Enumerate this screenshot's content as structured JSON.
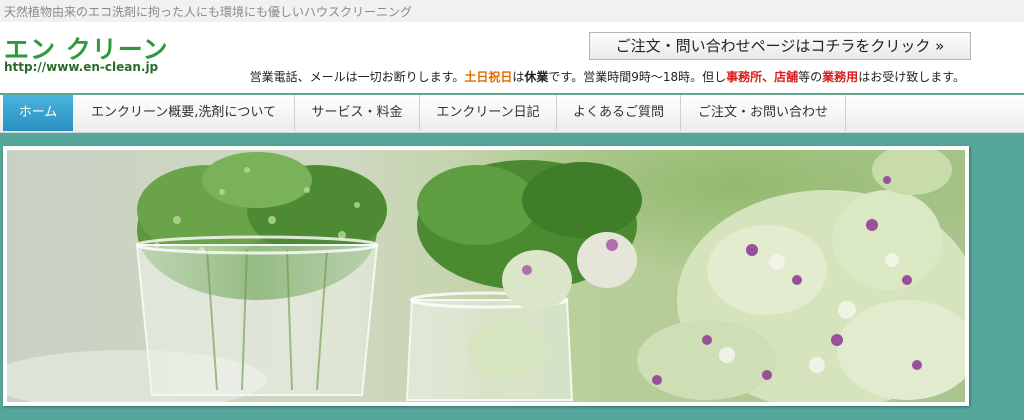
{
  "header": {
    "tagline": "天然植物由来のエコ洗剤に拘った人にも環境にも優しいハウスクリーニング",
    "logo": "エン クリーン",
    "url": "http://www.en-clean.jp",
    "contact_button": "ご注文・問い合わせページはコチラをクリック »",
    "notice": {
      "part1": "営業電話、メールは一切お断りします。",
      "holidays": "土日祝日",
      "part2": "は",
      "closed": "休業",
      "part3": "です。営業時間9時～18時。但し",
      "office": "事務所、店舗",
      "part4": "等の",
      "business": "業務用",
      "part5": "はお受け致します。"
    }
  },
  "nav": {
    "items": [
      {
        "label": "ホーム"
      },
      {
        "label": "エンクリーン概要,洗剤について"
      },
      {
        "label": "サービス・料金"
      },
      {
        "label": "エンクリーン日記"
      },
      {
        "label": "よくあるご質問"
      },
      {
        "label": "ご注文・お問い合わせ"
      }
    ]
  },
  "colors": {
    "accent_teal": "#56a79b",
    "logo_green": "#2f9a3c",
    "nav_active": "#2a8fc1",
    "notice_orange": "#e06a00",
    "notice_red": "#d81e1e"
  }
}
